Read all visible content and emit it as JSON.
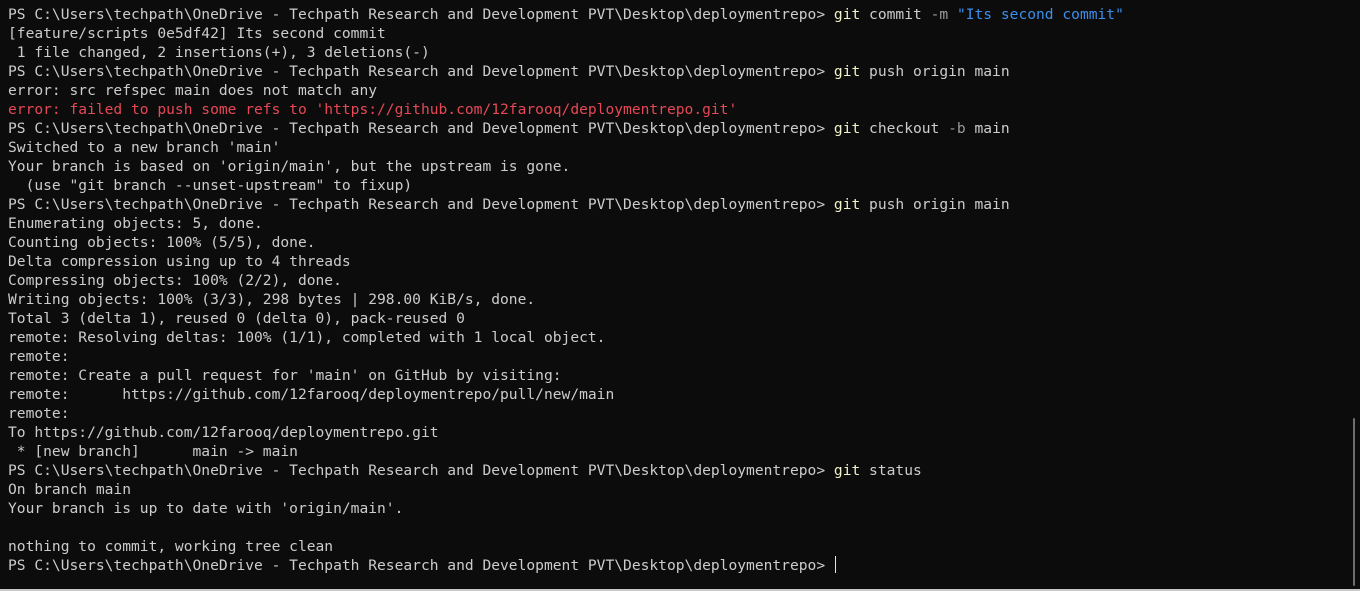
{
  "terminal": {
    "prompt": "PS C:\\Users\\techpath\\OneDrive - Techpath Research and Development PVT\\Desktop\\deploymentrepo> ",
    "lines": [
      {
        "type": "cmd",
        "git": "git",
        "args": " commit ",
        "flag": "-m",
        "rest": " ",
        "str": "\"Its second commit\""
      },
      {
        "type": "out",
        "text": "[feature/scripts 0e5df42] Its second commit"
      },
      {
        "type": "out",
        "text": " 1 file changed, 2 insertions(+), 3 deletions(-)"
      },
      {
        "type": "cmd",
        "git": "git",
        "args": " push origin main",
        "flag": "",
        "rest": "",
        "str": ""
      },
      {
        "type": "out",
        "text": "error: src refspec main does not match any"
      },
      {
        "type": "err",
        "text": "error: failed to push some refs to 'https://github.com/12farooq/deploymentrepo.git'"
      },
      {
        "type": "cmd",
        "git": "git",
        "args": " checkout ",
        "flag": "-b",
        "rest": " main",
        "str": ""
      },
      {
        "type": "out",
        "text": "Switched to a new branch 'main'"
      },
      {
        "type": "out",
        "text": "Your branch is based on 'origin/main', but the upstream is gone."
      },
      {
        "type": "out",
        "text": "  (use \"git branch --unset-upstream\" to fixup)"
      },
      {
        "type": "cmd",
        "git": "git",
        "args": " push origin main",
        "flag": "",
        "rest": "",
        "str": ""
      },
      {
        "type": "out",
        "text": "Enumerating objects: 5, done."
      },
      {
        "type": "out",
        "text": "Counting objects: 100% (5/5), done."
      },
      {
        "type": "out",
        "text": "Delta compression using up to 4 threads"
      },
      {
        "type": "out",
        "text": "Compressing objects: 100% (2/2), done."
      },
      {
        "type": "out",
        "text": "Writing objects: 100% (3/3), 298 bytes | 298.00 KiB/s, done."
      },
      {
        "type": "out",
        "text": "Total 3 (delta 1), reused 0 (delta 0), pack-reused 0"
      },
      {
        "type": "out",
        "text": "remote: Resolving deltas: 100% (1/1), completed with 1 local object."
      },
      {
        "type": "out",
        "text": "remote:"
      },
      {
        "type": "out",
        "text": "remote: Create a pull request for 'main' on GitHub by visiting:"
      },
      {
        "type": "out",
        "text": "remote:      https://github.com/12farooq/deploymentrepo/pull/new/main"
      },
      {
        "type": "out",
        "text": "remote:"
      },
      {
        "type": "out",
        "text": "To https://github.com/12farooq/deploymentrepo.git"
      },
      {
        "type": "out",
        "text": " * [new branch]      main -> main"
      },
      {
        "type": "cmd",
        "git": "git",
        "args": " status",
        "flag": "",
        "rest": "",
        "str": ""
      },
      {
        "type": "out",
        "text": "On branch main"
      },
      {
        "type": "out",
        "text": "Your branch is up to date with 'origin/main'."
      },
      {
        "type": "out",
        "text": ""
      },
      {
        "type": "out",
        "text": "nothing to commit, working tree clean"
      },
      {
        "type": "input",
        "text": ""
      }
    ]
  },
  "colors": {
    "background": "#0c0c0c",
    "text": "#cccccc",
    "git_command": "#f2f2c9",
    "flag": "#9a9a9a",
    "string": "#3b8eea",
    "error": "#e74856"
  }
}
